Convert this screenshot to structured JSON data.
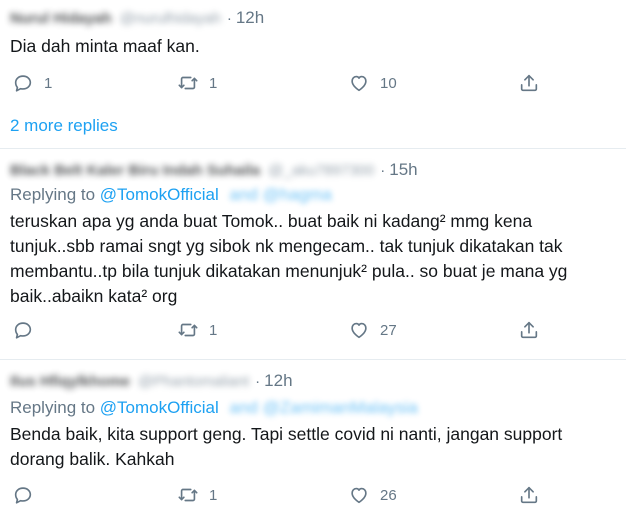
{
  "tweets": [
    {
      "name": "Nurul Hidayah",
      "handle": "@nurulhidayah",
      "time": "12h",
      "text": "Dia dah minta maaf kan.",
      "replies": "1",
      "retweets": "1",
      "likes": "10"
    },
    {
      "name": "Black Belt Kaler Biru Indah Suhaila",
      "handle": "@_aku7897300",
      "time": "15h",
      "replying_prefix": "Replying to",
      "replying_mention": "@TomokOfficial",
      "replying_blurred": "and @hagma",
      "text_lines": [
        "teruskan apa yg anda buat Tomok.. buat baik ni kadang² mmg kena",
        "tunjuk..sbb ramai sngt yg sibok nk mengecam.. tak tunjuk dikatakan tak",
        "membantu..tp bila tunjuk dikatakan menunjuk² pula.. so buat je mana yg",
        "baik..abaikn kata² org"
      ],
      "replies": "",
      "retweets": "1",
      "likes": "27"
    },
    {
      "name": "Ilus Hfiqylkhome",
      "handle": "@Phantomaliant",
      "time": "12h",
      "replying_prefix": "Replying to",
      "replying_mention": "@TomokOfficial",
      "replying_blurred": "and @ZamimanMalaysia",
      "text_lines": [
        "Benda baik, kita support geng. Tapi settle covid ni nanti, jangan support",
        "dorang balik. Kahkah"
      ],
      "replies": "",
      "retweets": "1",
      "likes": "26"
    }
  ],
  "more_replies": "2 more replies",
  "icons": {
    "reply": "reply-icon",
    "retweet": "retweet-icon",
    "like": "like-icon",
    "share": "share-icon"
  },
  "colors": {
    "link": "#1da1f2",
    "muted": "#657786",
    "text": "#14171a",
    "divider": "#e6ecf0"
  }
}
